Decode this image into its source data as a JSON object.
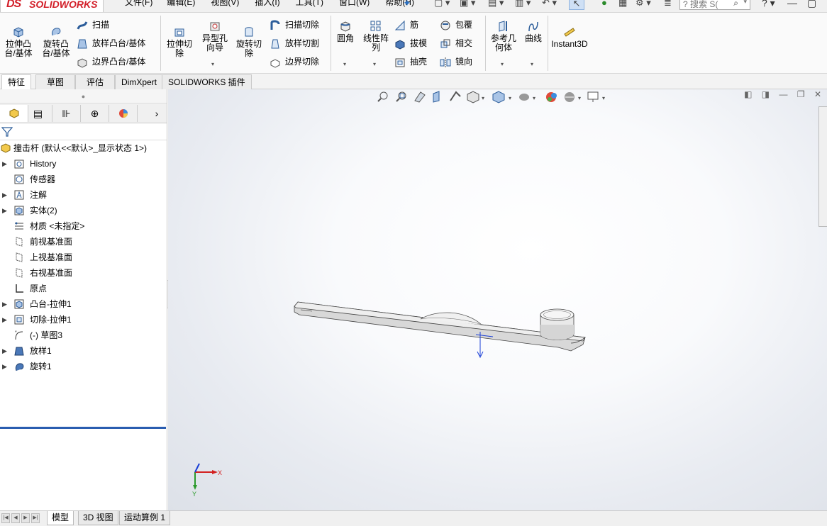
{
  "app": {
    "logo_ds": "DS",
    "logo_text": "SOLIDWORKS"
  },
  "menu": [
    "文件(F)",
    "编辑(E)",
    "视图(V)",
    "插入(I)",
    "工具(T)",
    "窗口(W)",
    "帮助(H)"
  ],
  "search": {
    "placeholder": "搜索 S("
  },
  "ribbon": {
    "extrude_boss": "拉伸凸\n台/基体",
    "revolve_boss": "旋转凸\n台/基体",
    "sweep": "扫描",
    "loft_boss": "放样凸台/基体",
    "boundary_boss": "边界凸台/基体",
    "extrude_cut": "拉伸切\n除",
    "hole_wizard": "异型孔\n向导",
    "revolve_cut": "旋转切\n除",
    "sweep_cut": "扫描切除",
    "loft_cut": "放样切割",
    "boundary_cut": "边界切除",
    "fillet": "圆角",
    "linear_pattern": "线性阵\n列",
    "rib": "筋",
    "draft": "拔模",
    "shell": "抽壳",
    "wrap": "包覆",
    "intersect": "相交",
    "mirror": "镜向",
    "ref_geometry": "参考几\n何体",
    "curves": "曲线",
    "instant3d": "Instant3D"
  },
  "command_tabs": [
    "特征",
    "草图",
    "评估",
    "DimXpert",
    "SOLIDWORKS 插件"
  ],
  "tree": {
    "root": "撞击杆 (默认<<默认>_显示状态 1>)",
    "items": [
      {
        "label": "History",
        "icon": "history-folder-icon",
        "expand": true
      },
      {
        "label": "传感器",
        "icon": "sensor-icon",
        "expand": false
      },
      {
        "label": "注解",
        "icon": "annotation-icon",
        "expand": true
      },
      {
        "label": "实体(2)",
        "icon": "solid-bodies-icon",
        "expand": true
      },
      {
        "label": "材质 <未指定>",
        "icon": "material-icon",
        "expand": false
      },
      {
        "label": "前视基准面",
        "icon": "plane-icon",
        "expand": false
      },
      {
        "label": "上视基准面",
        "icon": "plane-icon",
        "expand": false
      },
      {
        "label": "右视基准面",
        "icon": "plane-icon",
        "expand": false
      },
      {
        "label": "原点",
        "icon": "origin-icon",
        "expand": false
      },
      {
        "label": "凸台-拉伸1",
        "icon": "boss-extrude-icon",
        "expand": true
      },
      {
        "label": "切除-拉伸1",
        "icon": "cut-extrude-icon",
        "expand": true
      },
      {
        "label": "(-) 草图3",
        "icon": "sketch-icon",
        "expand": false
      },
      {
        "label": "放样1",
        "icon": "loft-icon",
        "expand": true
      },
      {
        "label": "旋转1",
        "icon": "revolve-icon",
        "expand": true
      }
    ]
  },
  "triad": {
    "x_label": "X",
    "y_label": "Y"
  },
  "bottom_tabs": [
    "模型",
    "3D 视图",
    "运动算例 1"
  ],
  "colors": {
    "accent": "#2a5db0",
    "brand": "#d3202a",
    "model_body": "#e6e6e6"
  }
}
